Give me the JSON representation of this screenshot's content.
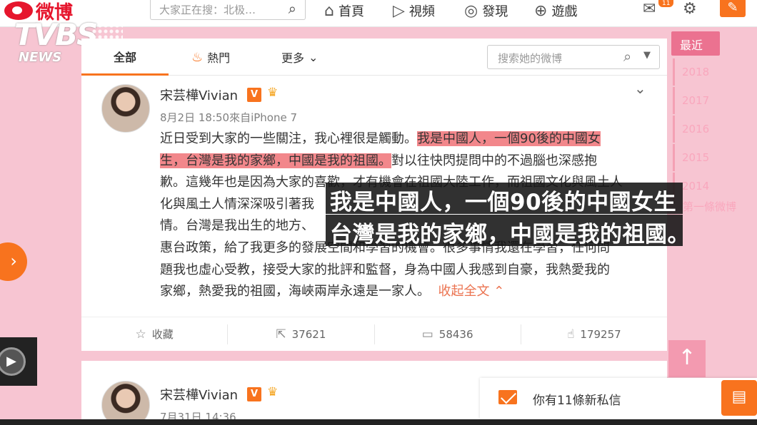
{
  "nav": {
    "brand": "微博",
    "search_placeholder": "大家正在搜：北极…",
    "items": [
      {
        "label": "首頁",
        "icon": "home-icon"
      },
      {
        "label": "視頻",
        "icon": "video-icon"
      },
      {
        "label": "發現",
        "icon": "compass-icon"
      },
      {
        "label": "遊戲",
        "icon": "gamepad-icon"
      }
    ],
    "badge": "11"
  },
  "watermark": {
    "line1": "TVBS",
    "line2": "NEWS"
  },
  "tabs": {
    "all": "全部",
    "hot": "熱門",
    "more": "更多",
    "search_placeholder": "搜索她的微博"
  },
  "post1": {
    "username": "宋芸樺Vivian",
    "v_badge": "V",
    "time": "8月2日 18:50來自iPhone 7",
    "lines": [
      {
        "a": "近日受到大家的一些關注，我心裡很是觸動。",
        "b": "我是中國人，一個90後的中國女",
        "c": ""
      },
      {
        "a": "",
        "b": "生，台灣是我的家鄉，中國是我的祖國。",
        "c": "對以往快閃提問中的不過腦也深感抱"
      },
      {
        "a": "歉。這幾年也是因為大家的喜歡，才有機會在祖國大陸工作，而祖國文化與風土人",
        "b": "",
        "c": ""
      },
      {
        "a": "化與風土人情深深吸引著我",
        "b": "",
        "c": ""
      },
      {
        "a": "情。台灣是我出生的地方、",
        "b": "",
        "c": ""
      },
      {
        "a": "惠台政策，給了我更多的發展空間和學習的機會。很多事情我還在學習，任何問",
        "b": "",
        "c": ""
      },
      {
        "a": "題我也虛心受教，接受大家的批評和監督，身為中國人我感到自豪，我熱愛我的",
        "b": "",
        "c": ""
      },
      {
        "a": "家鄉，熱愛我的祖國，海峽兩岸永遠是一家人。",
        "b": "",
        "c": ""
      }
    ],
    "collapse": "收起全文",
    "actions": {
      "favorite": "收藏",
      "repost": "37621",
      "comment": "58436",
      "like": "179257"
    }
  },
  "post2": {
    "username": "宋芸樺Vivian",
    "v_badge": "V",
    "time": "7月31日 14:36"
  },
  "subtitle": {
    "line1": "我是中國人，一個90後的中國女生",
    "line2": "台灣是我的家鄉，中國是我的祖國。"
  },
  "years": {
    "recent": "最近",
    "list": [
      "2018",
      "2017",
      "2016",
      "2015",
      "2014"
    ],
    "first_post": "第一條微博"
  },
  "messages": {
    "text": "你有11條新私信"
  },
  "colors": {
    "accent": "#f8731e",
    "weibo_red": "#e6162d",
    "highlight": "#f2878b",
    "background": "#f7c5d2"
  }
}
